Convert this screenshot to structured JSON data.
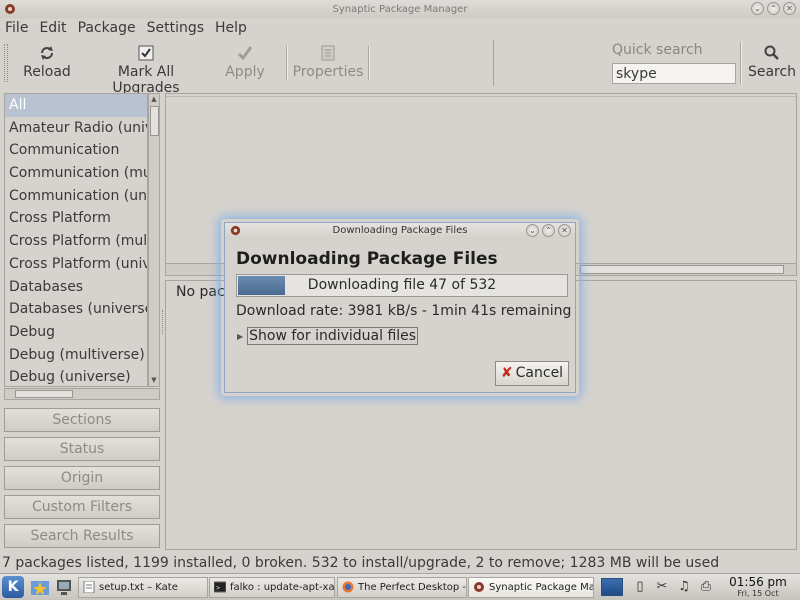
{
  "window": {
    "title": "Synaptic Package Manager"
  },
  "menu": [
    "File",
    "Edit",
    "Package",
    "Settings",
    "Help"
  ],
  "toolbar": {
    "reload": "Reload",
    "mark_all": "Mark All Upgrades",
    "apply": "Apply",
    "properties": "Properties",
    "quick_search_label": "Quick search",
    "quick_search_value": "skype",
    "search": "Search"
  },
  "categories": [
    "All",
    "Amateur Radio (univ",
    "Communication",
    "Communication (mu",
    "Communication (uni",
    "Cross Platform",
    "Cross Platform (mult",
    "Cross Platform (univ",
    "Databases",
    "Databases (universe)",
    "Debug",
    "Debug (multiverse)",
    "Debug (universe)"
  ],
  "filter_buttons": [
    "Sections",
    "Status",
    "Origin",
    "Custom Filters",
    "Search Results"
  ],
  "description_text": "No pack",
  "statusbar": "7 packages listed, 1199 installed, 0 broken. 532 to install/upgrade, 2 to remove; 1283 MB will be used",
  "dialog": {
    "title": "Downloading Package Files",
    "heading": "Downloading Package Files",
    "progress_text": "Downloading file 47 of 532",
    "progress_fraction": 0.1428,
    "rate_text": "Download rate: 3981 kB/s - 1min 41s remaining",
    "expander": "Show for individual files",
    "cancel": "Cancel"
  },
  "taskbar": {
    "tasks": [
      "setup.txt – Kate",
      "falko : update-apt-xapi",
      "The Perfect Desktop -",
      "Synaptic Package Mana"
    ],
    "time": "01:56 pm",
    "date": "Fri, 15 Oct"
  },
  "colors": {
    "progress_fill": "#4a6a92",
    "selection": "#b8c2d0",
    "glow": "#78aae6"
  }
}
